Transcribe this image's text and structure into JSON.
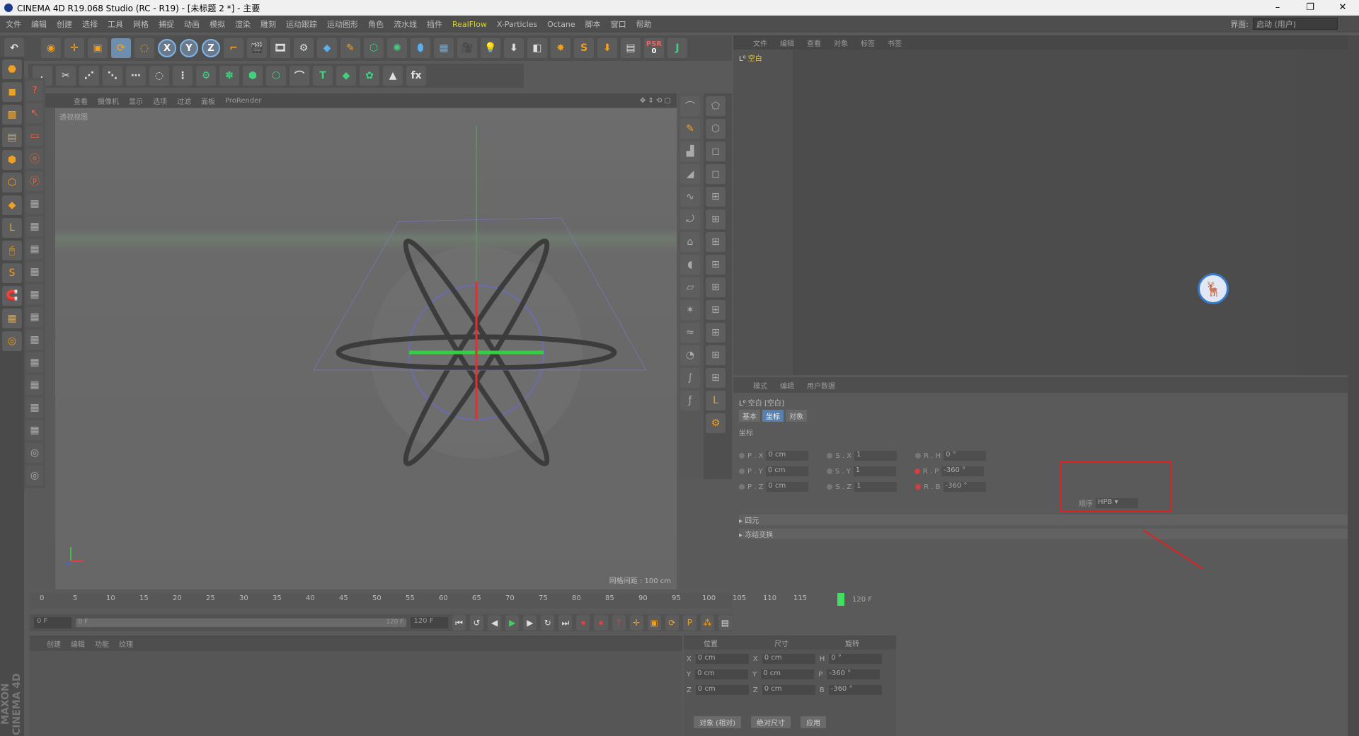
{
  "window": {
    "title": "CINEMA 4D R19.068 Studio (RC - R19) - [未标题 2 *] - 主要",
    "controls": [
      "–",
      "❐",
      "✕"
    ]
  },
  "menubar": {
    "items": [
      "文件",
      "编辑",
      "创建",
      "选择",
      "工具",
      "网格",
      "捕捉",
      "动画",
      "模拟",
      "渲染",
      "雕刻",
      "运动跟踪",
      "运动图形",
      "角色",
      "流水线",
      "插件",
      "RealFlow",
      "X-Particles",
      "Octane",
      "脚本",
      "窗口",
      "帮助"
    ],
    "layout_label": "界面:",
    "layout_value": "启动 (用户)"
  },
  "toolbar_top": {
    "undo": "↶",
    "axis_x": "X",
    "axis_y": "Y",
    "axis_z": "Z",
    "psr_label": "PSR",
    "psr_value": "0"
  },
  "viewport": {
    "menu": [
      "查看",
      "摄像机",
      "显示",
      "选项",
      "过滤",
      "面板",
      "ProRender"
    ],
    "label": "透视视图",
    "grid_text": "网格间距 : 100 cm"
  },
  "object_manager": {
    "menu": [
      "文件",
      "编辑",
      "查看",
      "对象",
      "标签",
      "书签"
    ],
    "object_name": "空白"
  },
  "attribute_manager": {
    "menu": [
      "模式",
      "编辑",
      "用户数据"
    ],
    "title": "空白 [空白]",
    "tabs": [
      "基本",
      "坐标",
      "对象"
    ],
    "active_tab": "坐标",
    "section": "坐标",
    "rows": [
      {
        "p_label": "P . X",
        "p_val": "0 cm",
        "s_label": "S . X",
        "s_val": "1",
        "r_label": "R . H",
        "r_val": "0 °"
      },
      {
        "p_label": "P . Y",
        "p_val": "0 cm",
        "s_label": "S . Y",
        "s_val": "1",
        "r_label": "R . P",
        "r_val": "-360 °"
      },
      {
        "p_label": "P . Z",
        "p_val": "0 cm",
        "s_label": "S . Z",
        "s_val": "1",
        "r_label": "R . B",
        "r_val": "-360 °"
      }
    ],
    "order_label": "顺序",
    "order_value": "HPB",
    "folds": [
      "▸ 四元",
      "▸ 冻结变换"
    ]
  },
  "timeline": {
    "ticks": [
      "0",
      "5",
      "10",
      "15",
      "20",
      "25",
      "30",
      "35",
      "40",
      "45",
      "50",
      "55",
      "60",
      "65",
      "70",
      "75",
      "80",
      "85",
      "90",
      "95",
      "100",
      "105",
      "110",
      "115"
    ],
    "end_frame": "120 F"
  },
  "transport": {
    "start": "0 F",
    "slider_left": "0 F",
    "slider_right": "120 F",
    "end": "120 F"
  },
  "material_manager": {
    "menu": [
      "创建",
      "编辑",
      "功能",
      "纹理"
    ]
  },
  "coord_manager": {
    "headers": [
      "位置",
      "尺寸",
      "旋转"
    ],
    "rows": [
      {
        "a": "X",
        "av": "0 cm",
        "b": "X",
        "bv": "0 cm",
        "c": "H",
        "cv": "0 °"
      },
      {
        "a": "Y",
        "av": "0 cm",
        "b": "Y",
        "bv": "0 cm",
        "c": "P",
        "cv": "-360 °"
      },
      {
        "a": "Z",
        "av": "0 cm",
        "b": "Z",
        "bv": "0 cm",
        "c": "B",
        "cv": "-360 °"
      }
    ],
    "mode": "对象 (相对)",
    "size_mode": "绝对尺寸",
    "apply": "应用"
  },
  "branding": "MAXON CINEMA 4D",
  "watermark_icon": "deer-logo-icon",
  "colors": {
    "accent_blue": "#5680b0",
    "highlight_red": "#e02020",
    "playhead_green": "#40e060",
    "object_yellow": "#e0c040"
  }
}
